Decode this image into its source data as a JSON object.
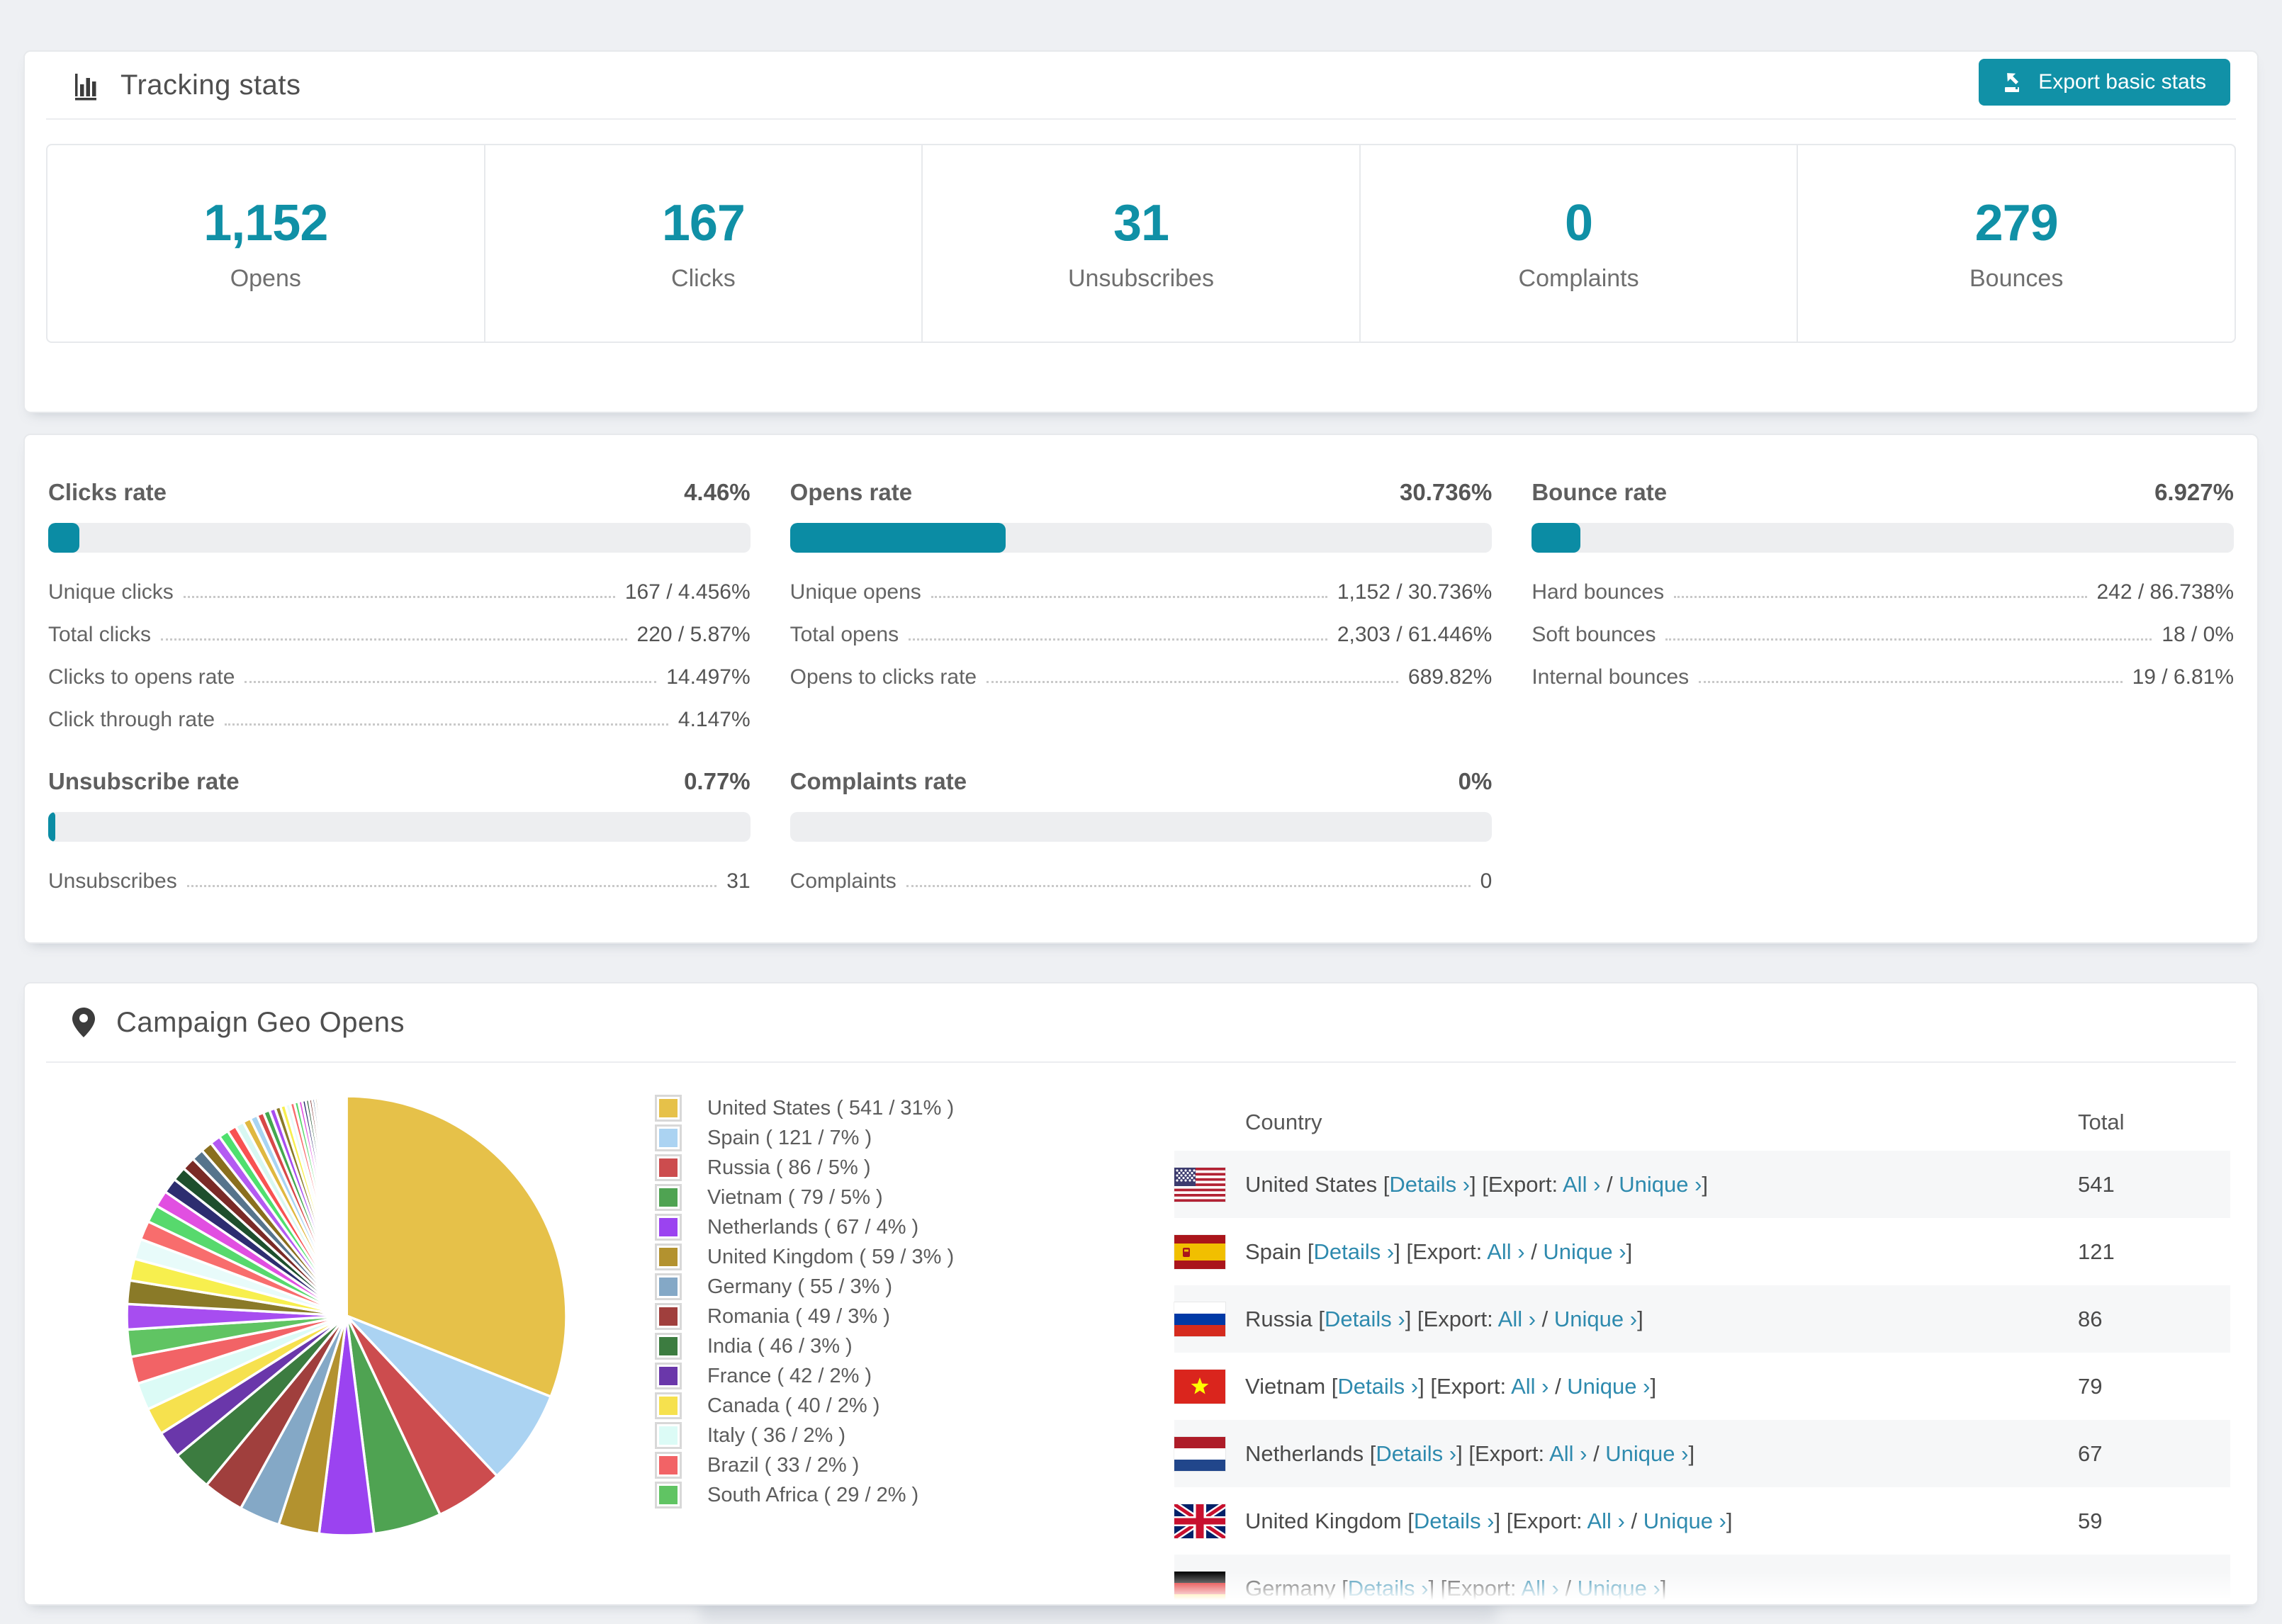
{
  "colors": {
    "accent": "#0b8ca4",
    "button": "#1191a7",
    "link": "#2e8aae",
    "number": "#1090a6",
    "bar_track": "#edeef0",
    "page_bg": "#eef0f3"
  },
  "tracking": {
    "title": "Tracking stats",
    "export_label": "Export basic stats",
    "stats": [
      {
        "value": "1,152",
        "label": "Opens"
      },
      {
        "value": "167",
        "label": "Clicks"
      },
      {
        "value": "31",
        "label": "Unsubscribes"
      },
      {
        "value": "0",
        "label": "Complaints"
      },
      {
        "value": "279",
        "label": "Bounces"
      }
    ]
  },
  "rates": [
    {
      "title": "Clicks rate",
      "value": "4.46%",
      "percent": 4.46,
      "rows": [
        {
          "label": "Unique clicks",
          "value": "167 / 4.456%"
        },
        {
          "label": "Total clicks",
          "value": "220 / 5.87%"
        },
        {
          "label": "Clicks to opens rate",
          "value": "14.497%"
        },
        {
          "label": "Click through rate",
          "value": "4.147%"
        }
      ]
    },
    {
      "title": "Opens rate",
      "value": "30.736%",
      "percent": 30.736,
      "rows": [
        {
          "label": "Unique opens",
          "value": "1,152 / 30.736%"
        },
        {
          "label": "Total opens",
          "value": "2,303 / 61.446%"
        },
        {
          "label": "Opens to clicks rate",
          "value": "689.82%"
        }
      ]
    },
    {
      "title": "Bounce rate",
      "value": "6.927%",
      "percent": 6.927,
      "rows": [
        {
          "label": "Hard bounces",
          "value": "242 / 86.738%"
        },
        {
          "label": "Soft bounces",
          "value": "18 / 0%"
        },
        {
          "label": "Internal bounces",
          "value": "19 / 6.81%"
        }
      ]
    },
    {
      "title": "Unsubscribe rate",
      "value": "0.77%",
      "percent": 0.77,
      "rows": [
        {
          "label": "Unsubscribes",
          "value": "31"
        }
      ]
    },
    {
      "title": "Complaints rate",
      "value": "0%",
      "percent": 0,
      "rows": [
        {
          "label": "Complaints",
          "value": "0"
        }
      ]
    }
  ],
  "geo": {
    "title": "Campaign Geo Opens",
    "chart_data": {
      "type": "pie",
      "title": "Campaign Geo Opens",
      "legend_position": "right",
      "series": [
        {
          "name": "United States",
          "value": 541,
          "percent": 31,
          "color": "#e6c149"
        },
        {
          "name": "Spain",
          "value": 121,
          "percent": 7,
          "color": "#abd3f2"
        },
        {
          "name": "Russia",
          "value": 86,
          "percent": 5,
          "color": "#cc4c4e"
        },
        {
          "name": "Vietnam",
          "value": 79,
          "percent": 5,
          "color": "#4fa352"
        },
        {
          "name": "Netherlands",
          "value": 67,
          "percent": 4,
          "color": "#9b43f0"
        },
        {
          "name": "United Kingdom",
          "value": 59,
          "percent": 3,
          "color": "#b3922f"
        },
        {
          "name": "Germany",
          "value": 55,
          "percent": 3,
          "color": "#84a8c6"
        },
        {
          "name": "Romania",
          "value": 49,
          "percent": 3,
          "color": "#a03f3d"
        },
        {
          "name": "India",
          "value": 46,
          "percent": 3,
          "color": "#3c7c40"
        },
        {
          "name": "France",
          "value": 42,
          "percent": 2,
          "color": "#6a37aa"
        },
        {
          "name": "Canada",
          "value": 40,
          "percent": 2,
          "color": "#f6e14e"
        },
        {
          "name": "Italy",
          "value": 36,
          "percent": 2,
          "color": "#dcfbf6"
        },
        {
          "name": "Brazil",
          "value": 33,
          "percent": 2,
          "color": "#f26366"
        },
        {
          "name": "South Africa",
          "value": 29,
          "percent": 2,
          "color": "#60c463"
        }
      ],
      "others": {
        "percent": 26,
        "slice_count": 55,
        "decay": 0.93,
        "colors": [
          "#a74df0",
          "#8a7a28",
          "#f7ef4e",
          "#e8fbfa",
          "#f86d6d",
          "#57d96d",
          "#e14fe1",
          "#2d2d70",
          "#1e4f2d",
          "#7a2a26",
          "#56748c",
          "#8a6f1e",
          "#b45af2",
          "#4fe06e",
          "#f85252",
          "#d8f8f2",
          "#e0b840",
          "#a8d4f2",
          "#d84848",
          "#44a84f"
        ]
      }
    },
    "legend_format": {
      "open": "( ",
      "sep": " / ",
      "pct": "%",
      "close": " )"
    },
    "table": {
      "headers": [
        "Country",
        "Total"
      ],
      "links": {
        "details": "Details ›",
        "all": "All ›",
        "unique": "Unique ›",
        "bracket_open": "[",
        "bracket_close": "]",
        "export_prefix": "[Export:",
        "slash": "/"
      },
      "rows": [
        {
          "country": "United States",
          "flag": "us",
          "total": "541"
        },
        {
          "country": "Spain",
          "flag": "es",
          "total": "121"
        },
        {
          "country": "Russia",
          "flag": "ru",
          "total": "86"
        },
        {
          "country": "Vietnam",
          "flag": "vn",
          "total": "79"
        },
        {
          "country": "Netherlands",
          "flag": "nl",
          "total": "67"
        },
        {
          "country": "United Kingdom",
          "flag": "gb",
          "total": "59"
        },
        {
          "country": "Germany",
          "flag": "de",
          "total": ""
        }
      ]
    }
  }
}
